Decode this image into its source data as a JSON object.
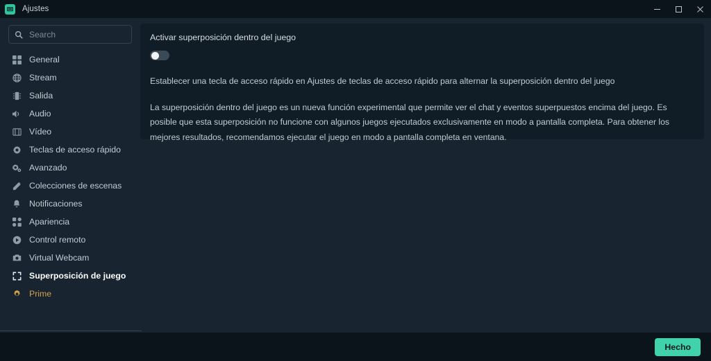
{
  "window": {
    "title": "Ajustes",
    "app_icon": "stream-deck-icon",
    "controls": [
      {
        "name": "minimize-button",
        "icon": "minimize-icon",
        "label": "Minimizar"
      },
      {
        "name": "maximize-button",
        "icon": "maximize-icon",
        "label": "Maximizar"
      },
      {
        "name": "close-button",
        "icon": "close-icon",
        "label": "Cerrar"
      }
    ]
  },
  "sidebar": {
    "search": {
      "icon": "search-icon",
      "placeholder": "Search",
      "value": ""
    },
    "items": [
      {
        "label": "General",
        "icon": "grid-icon",
        "active": false,
        "accent": false
      },
      {
        "label": "Stream",
        "icon": "globe-icon",
        "active": false,
        "accent": false
      },
      {
        "label": "Salida",
        "icon": "output-icon",
        "active": false,
        "accent": false
      },
      {
        "label": "Audio",
        "icon": "speaker-icon",
        "active": false,
        "accent": false
      },
      {
        "label": "Vídeo",
        "icon": "film-icon",
        "active": false,
        "accent": false
      },
      {
        "label": "Teclas de acceso rápido",
        "icon": "gear-icon",
        "active": false,
        "accent": false
      },
      {
        "label": "Avanzado",
        "icon": "gears-icon",
        "active": false,
        "accent": false
      },
      {
        "label": "Colecciones de escenas",
        "icon": "scenes-icon",
        "active": false,
        "accent": false
      },
      {
        "label": "Notificaciones",
        "icon": "bell-icon",
        "active": false,
        "accent": false
      },
      {
        "label": "Apariencia",
        "icon": "appearance-icon",
        "active": false,
        "accent": false
      },
      {
        "label": "Control remoto",
        "icon": "remote-control-icon",
        "active": false,
        "accent": false
      },
      {
        "label": "Virtual Webcam",
        "icon": "camera-icon",
        "active": false,
        "accent": false
      },
      {
        "label": "Superposición de juego",
        "icon": "fullscreen-icon",
        "active": true,
        "accent": false
      },
      {
        "label": "Prime",
        "icon": "prime-crown-icon",
        "active": false,
        "accent": true
      }
    ]
  },
  "content": {
    "toggle_label": "Activar superposición dentro del juego",
    "toggle_state": "off",
    "hint": "Establecer una tecla de acceso rápido en Ajustes de teclas de acceso rápido para alternar la superposición dentro del juego",
    "paragraph": "La superposición dentro del juego es un nueva función experimental que permite ver el chat y eventos superpuestos encima del juego. Es posible que esta superposición no funcione con algunos juegos ejecutados exclusivamente en modo a pantalla completa. Para obtener los mejores resultados, recomendamos ejecutar el juego en modo a pantalla completa en ventana."
  },
  "footer": {
    "done_label": "Hecho"
  },
  "colors": {
    "accent": "#3fd2ab",
    "prime": "#d2a14c",
    "background": "#182530",
    "panel": "#101d26",
    "titlebar": "#0b141b"
  }
}
